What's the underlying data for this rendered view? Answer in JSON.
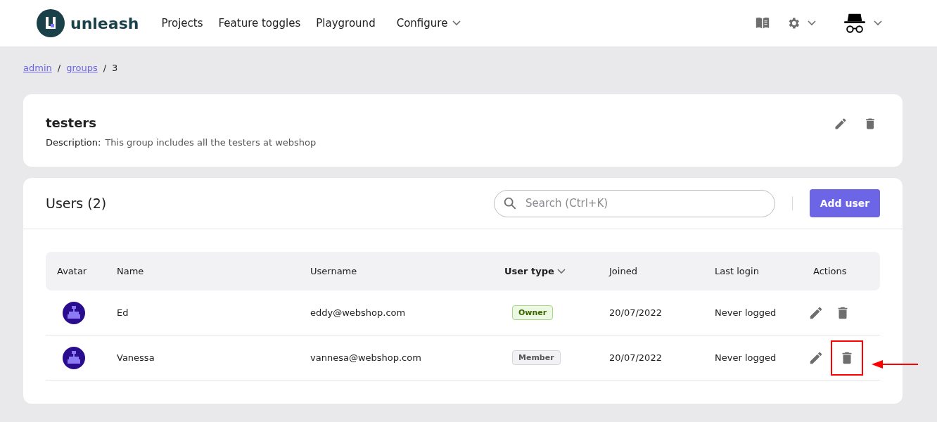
{
  "header": {
    "logo": "unleash",
    "nav": [
      {
        "label": "Projects",
        "dropdown": false
      },
      {
        "label": "Feature toggles",
        "dropdown": false
      },
      {
        "label": "Playground",
        "dropdown": false
      },
      {
        "label": "Configure",
        "dropdown": true
      }
    ]
  },
  "breadcrumbs": {
    "separator": "/",
    "items": [
      {
        "label": "admin",
        "link": true
      },
      {
        "label": "groups",
        "link": true
      },
      {
        "label": "3",
        "link": false
      }
    ]
  },
  "group": {
    "name": "testers",
    "description_label": "Description:",
    "description": "This group includes all the testers at webshop"
  },
  "users": {
    "title": "Users (2)",
    "search": {
      "placeholder": "Search (Ctrl+K)"
    },
    "add_button": "Add user",
    "table": {
      "columns": [
        {
          "label": "Avatar",
          "sorted": false
        },
        {
          "label": "Name",
          "sorted": false
        },
        {
          "label": "Username",
          "sorted": false
        },
        {
          "label": "User type",
          "sorted": true
        },
        {
          "label": "Joined",
          "sorted": false
        },
        {
          "label": "Last login",
          "sorted": false
        },
        {
          "label": "Actions",
          "sorted": false
        }
      ],
      "rows": [
        {
          "name": "Ed",
          "username": "eddy@webshop.com",
          "user_type": {
            "label": "Owner",
            "kind": "owner"
          },
          "joined": "20/07/2022",
          "last_login": "Never logged",
          "highlighted": false
        },
        {
          "name": "Vanessa",
          "username": "vannesa@webshop.com",
          "user_type": {
            "label": "Member",
            "kind": "member"
          },
          "joined": "20/07/2022",
          "last_login": "Never logged",
          "highlighted": true
        }
      ]
    }
  }
}
